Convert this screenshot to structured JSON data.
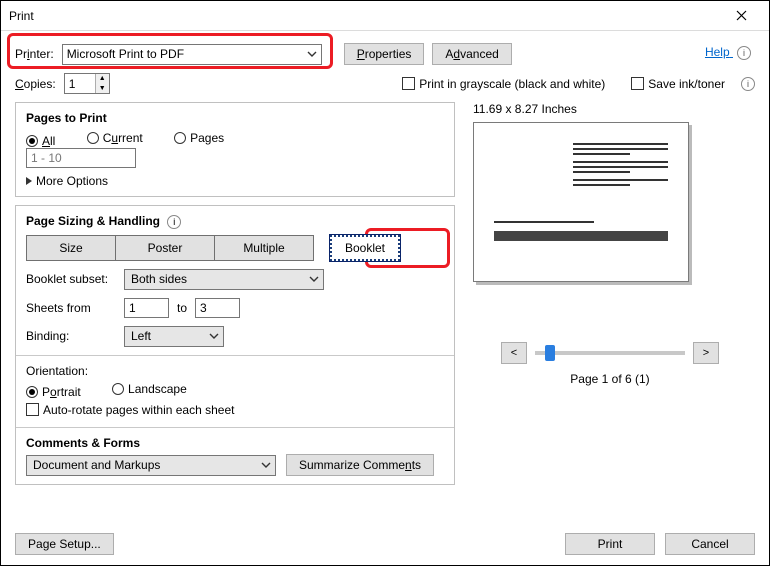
{
  "window": {
    "title": "Print"
  },
  "top": {
    "printer_label": "Printer:",
    "printer_value": "Microsoft Print to PDF",
    "properties_btn": "Properties",
    "advanced_btn": "Advanced",
    "help_label": "Help",
    "copies_label": "Copies:",
    "copies_value": "1",
    "grayscale_label": "Print in grayscale (black and white)",
    "saveink_label": "Save ink/toner"
  },
  "pages": {
    "title": "Pages to Print",
    "all": "All",
    "current": "Current",
    "pages": "Pages",
    "range_placeholder": "1 - 10",
    "more_options": "More Options"
  },
  "sizing": {
    "title": "Page Sizing & Handling",
    "size": "Size",
    "poster": "Poster",
    "multiple": "Multiple",
    "booklet": "Booklet",
    "subset_label": "Booklet subset:",
    "subset_value": "Both sides",
    "sheets_from_label": "Sheets from",
    "sheets_from": "1",
    "sheets_to_label": "to",
    "sheets_to": "3",
    "binding_label": "Binding:",
    "binding_value": "Left"
  },
  "orientation": {
    "title": "Orientation:",
    "portrait": "Portrait",
    "landscape": "Landscape",
    "autorotate": "Auto-rotate pages within each sheet"
  },
  "comments": {
    "title": "Comments & Forms",
    "value": "Document and Markups",
    "summarize": "Summarize Comments"
  },
  "preview": {
    "dimensions": "11.69 x 8.27 Inches",
    "nav_prev": "<",
    "nav_next": ">",
    "page_indicator": "Page 1 of 6 (1)"
  },
  "footer": {
    "page_setup": "Page Setup...",
    "print": "Print",
    "cancel": "Cancel"
  }
}
